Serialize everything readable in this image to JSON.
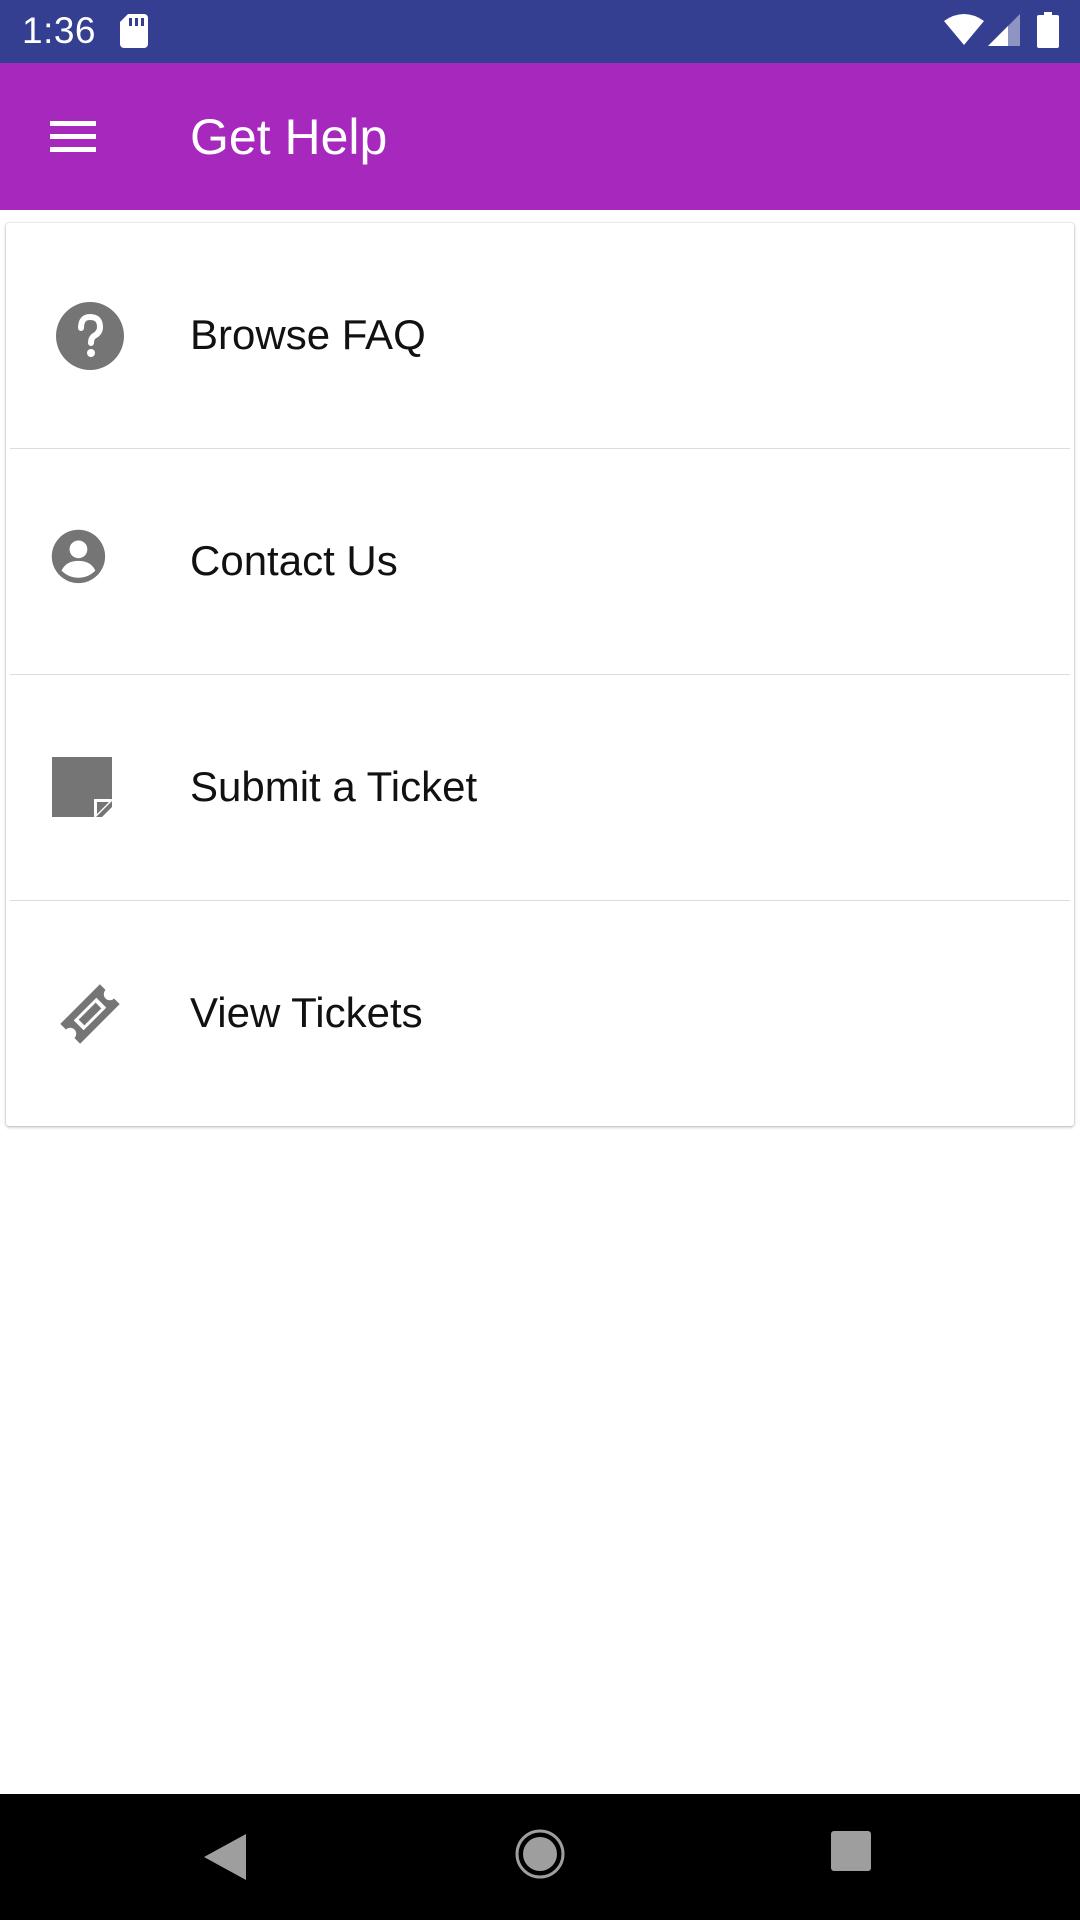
{
  "status_bar": {
    "time": "1:36",
    "icons": [
      "sd-card-icon",
      "wifi-icon",
      "signal-icon",
      "battery-icon"
    ],
    "background": "#343f92"
  },
  "app_bar": {
    "title": "Get Help",
    "menu_icon": "hamburger-menu-icon",
    "background": "#a728bc"
  },
  "menu": {
    "items": [
      {
        "label": "Browse FAQ",
        "icon": "help-circle-icon"
      },
      {
        "label": "Contact Us",
        "icon": "account-circle-icon"
      },
      {
        "label": "Submit a Ticket",
        "icon": "note-icon"
      },
      {
        "label": "View Tickets",
        "icon": "ticket-icon"
      }
    ],
    "icon_color": "#757575"
  },
  "nav_bar": {
    "buttons": [
      "back-triangle-icon",
      "home-circle-icon",
      "recents-square-icon"
    ]
  }
}
